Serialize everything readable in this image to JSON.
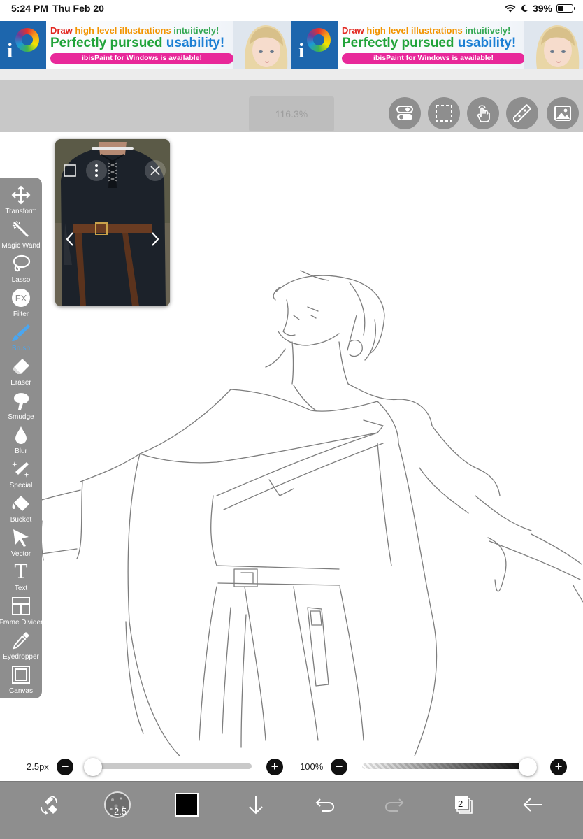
{
  "status_bar": {
    "time": "5:24 PM",
    "date": "Thu Feb 20",
    "battery": "39%"
  },
  "ad": {
    "line1_red": "Draw",
    "line1_orange": "high level illustrations",
    "line1_green": "intuitively!",
    "line2_green": "Perfectly pursued",
    "line2_blue": "usability!",
    "line3": "ibisPaint for Windows is available!"
  },
  "topbar": {
    "zoom": "116.3%"
  },
  "tools": [
    {
      "id": "transform",
      "label": "Transform"
    },
    {
      "id": "magic-wand",
      "label": "Magic Wand"
    },
    {
      "id": "lasso",
      "label": "Lasso"
    },
    {
      "id": "filter",
      "label": "Filter",
      "icon_text": "FX"
    },
    {
      "id": "brush",
      "label": "Brush",
      "active": true
    },
    {
      "id": "eraser",
      "label": "Eraser"
    },
    {
      "id": "smudge",
      "label": "Smudge"
    },
    {
      "id": "blur",
      "label": "Blur"
    },
    {
      "id": "special",
      "label": "Special"
    },
    {
      "id": "bucket",
      "label": "Bucket"
    },
    {
      "id": "vector",
      "label": "Vector"
    },
    {
      "id": "text",
      "label": "Text",
      "icon_text": "T"
    },
    {
      "id": "frame-divider",
      "label": "Frame Divider"
    },
    {
      "id": "eyedropper",
      "label": "Eyedropper"
    },
    {
      "id": "canvas",
      "label": "Canvas"
    }
  ],
  "sliders": {
    "brush_size": "2.5px",
    "brush_size_fraction": 0.0,
    "opacity": "100%",
    "opacity_fraction": 1.0,
    "minus": "−",
    "plus": "+"
  },
  "bottom_bar": {
    "brush_size_value": "2.5",
    "layer_count": "2",
    "color": "#000000"
  },
  "colors": {
    "toolbar": "#8e8e8e",
    "active_tool": "#4aa6f0",
    "ad_pink": "#e8289a"
  }
}
